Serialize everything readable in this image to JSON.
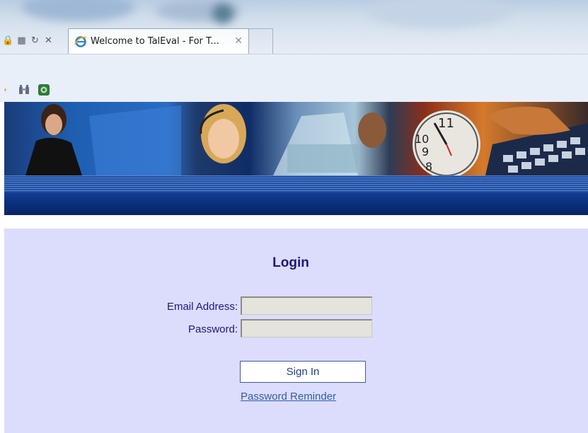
{
  "browser": {
    "tab_title": "Welcome to TalEval - For T...",
    "tab_close_glyph": "✕",
    "nav_icons": [
      "lock-icon",
      "compatibility-icon",
      "refresh-icon",
      "stop-icon"
    ],
    "nav_glyphs": [
      "🔒",
      "▦",
      "↻",
      "✕"
    ],
    "toolbar_icons": [
      "arrow-icon",
      "binoculars-icon",
      "evernote-icon"
    ]
  },
  "login": {
    "title": "Login",
    "email_label": "Email Address:",
    "email_value": "",
    "password_label": "Password:",
    "password_value": "",
    "sign_in_label": "Sign In",
    "reminder_label": "Password Reminder"
  },
  "colors": {
    "panel_bg": "#dcdcfc",
    "label_color": "#1a1a78",
    "link_color": "#2f5fa8",
    "banner_bar": "#0a2f7c"
  }
}
